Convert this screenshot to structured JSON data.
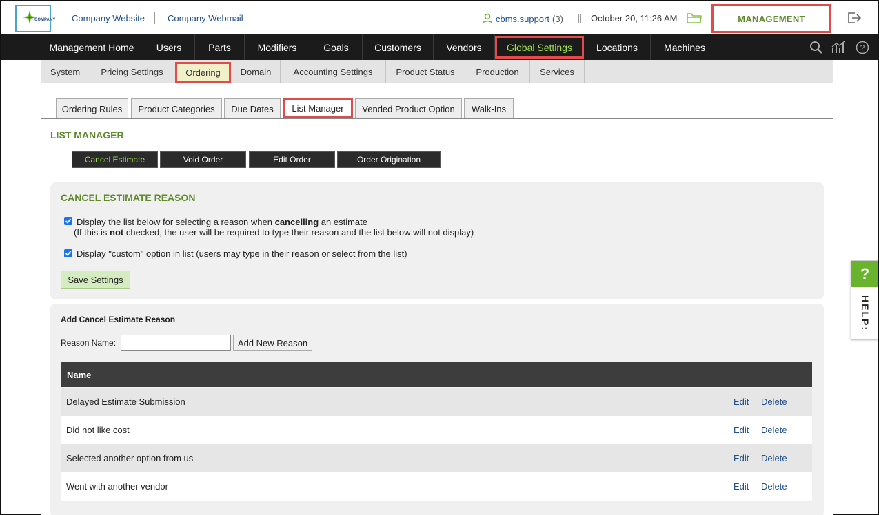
{
  "header": {
    "logo_text": "COMPANY",
    "links": [
      "Company Website",
      "Company Webmail"
    ],
    "user": "cbms.support",
    "user_count": "(3)",
    "datetime": "October 20, 11:26 AM",
    "management_label": "MANAGEMENT"
  },
  "main_nav": {
    "items": [
      "Management Home",
      "Users",
      "Parts",
      "Modifiers",
      "Goals",
      "Customers",
      "Vendors",
      "Global Settings",
      "Locations",
      "Machines"
    ],
    "active": "Global Settings"
  },
  "sub_nav": {
    "items": [
      "System",
      "Pricing Settings",
      "Ordering",
      "Domain",
      "Accounting Settings",
      "Product Status",
      "Production",
      "Services"
    ],
    "active": "Ordering"
  },
  "tabs": {
    "items": [
      "Ordering Rules",
      "Product Categories",
      "Due Dates",
      "List Manager",
      "Vended Product Option",
      "Walk-Ins"
    ],
    "active": "List Manager"
  },
  "list_manager": {
    "title": "LIST MANAGER",
    "buttons": [
      "Cancel Estimate",
      "Void Order",
      "Edit Order",
      "Order Origination"
    ],
    "active_button": "Cancel Estimate"
  },
  "settings_panel": {
    "title": "CANCEL ESTIMATE REASON",
    "option1_pre": "Display the list below for selecting a reason when ",
    "option1_bold": "cancelling",
    "option1_post": " an estimate",
    "option1_note_pre": "(If this is ",
    "option1_note_bold": "not",
    "option1_note_post": " checked, the user will be required to type their reason and the list below will not display)",
    "option1_checked": true,
    "option2": "Display \"custom\" option in list (users may type in their reason or select from the list)",
    "option2_checked": true,
    "save_label": "Save Settings"
  },
  "add_panel": {
    "title": "Add Cancel Estimate Reason",
    "reason_label": "Reason Name:",
    "reason_value": "",
    "add_label": "Add New Reason",
    "table_header": "Name",
    "edit_label": "Edit",
    "delete_label": "Delete",
    "rows": [
      "Delayed Estimate Submission",
      "Did not like cost",
      "Selected another option from us",
      "Went with another vendor"
    ]
  },
  "help": {
    "label": "HELP:",
    "symbol": "?"
  },
  "colors": {
    "accent_green": "#5f8a2c",
    "highlight_red": "#e44a4a",
    "nav_dark": "#1b1b1b",
    "link_blue": "#1f4d8c"
  }
}
